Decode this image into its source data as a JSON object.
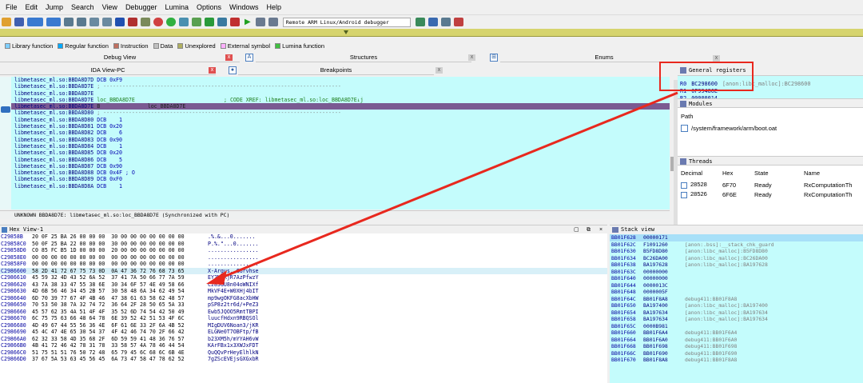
{
  "menu": [
    "File",
    "Edit",
    "Jump",
    "Search",
    "View",
    "Debugger",
    "Lumina",
    "Options",
    "Windows",
    "Help"
  ],
  "toolbar": {
    "debugger_select": "Remote ARM Linux/Android debugger"
  },
  "legend": [
    {
      "label": "Library function",
      "color": "#7fcfff"
    },
    {
      "label": "Regular function",
      "color": "#00aaff"
    },
    {
      "label": "Instruction",
      "color": "#c07060"
    },
    {
      "label": "Data",
      "color": "#c0c0c0"
    },
    {
      "label": "Unexplored",
      "color": "#b0b060"
    },
    {
      "label": "External symbol",
      "color": "#ffb0ff"
    },
    {
      "label": "Lumina function",
      "color": "#40c040"
    }
  ],
  "panes": {
    "debug_view": "Debug View",
    "structures": "Structures",
    "enums": "Enums",
    "ida_view": "IDA View-PC",
    "breakpoints": "Breakpoints",
    "general_registers": "General registers",
    "modules": "Modules",
    "threads": "Threads",
    "hex_view": "Hex View-1",
    "stack_view": "Stack view"
  },
  "ida_lines": [
    {
      "addr": "libmetasec_ml.so:BBDA8D7D",
      "body": " DCB 0xF9",
      "cls": "bl"
    },
    {
      "addr": "libmetasec_ml.so:BBDA8D7E",
      "body": " ; ---------------------------------------------------------------------------",
      "cls": "gy"
    },
    {
      "addr": "libmetasec_ml.so:BBDA8D7E",
      "body": "",
      "cls": ""
    },
    {
      "addr": "libmetasec_ml.so:BBDA8D7E",
      "body": " loc_BBDA8D7E                            ; CODE XREF: libmetasec_ml.so:loc_BBDA8D7E↓j",
      "cls": "gr"
    },
    {
      "addr": "libmetasec_ml.so:BBDA8D7E",
      "body": " B               loc_BBDA8D7E",
      "cls": "hl"
    },
    {
      "addr": "libmetasec_ml.so:BBDA8D80",
      "body": " ; ---------------------------------------------------------------------------",
      "cls": "gy"
    },
    {
      "addr": "libmetasec_ml.so:BBDA8D80",
      "body": " DCB    1",
      "cls": "bl"
    },
    {
      "addr": "libmetasec_ml.so:BBDA8D81",
      "body": " DCB 0x20",
      "cls": "bl"
    },
    {
      "addr": "libmetasec_ml.so:BBDA8D82",
      "body": " DCB    6",
      "cls": "bl"
    },
    {
      "addr": "libmetasec_ml.so:BBDA8D83",
      "body": " DCB 0x90",
      "cls": "bl"
    },
    {
      "addr": "libmetasec_ml.so:BBDA8D84",
      "body": " DCB    1",
      "cls": "bl"
    },
    {
      "addr": "libmetasec_ml.so:BBDA8D85",
      "body": " DCB 0x20",
      "cls": "bl"
    },
    {
      "addr": "libmetasec_ml.so:BBDA8D86",
      "body": " DCB    5",
      "cls": "bl"
    },
    {
      "addr": "libmetasec_ml.so:BBDA8D87",
      "body": " DCB 0x90",
      "cls": "bl"
    },
    {
      "addr": "libmetasec_ml.so:BBDA8D88",
      "body": " DCB 0x4F ; O",
      "cls": "bl"
    },
    {
      "addr": "libmetasec_ml.so:BBDA8D89",
      "body": " DCB 0xF0",
      "cls": "bl"
    },
    {
      "addr": "libmetasec_ml.so:BBDA8D8A",
      "body": " DCB    1",
      "cls": "bl"
    }
  ],
  "ida_status": "UNKNOWN BBDA8D7E: libmetasec_ml.so:loc_BBDA8D7E (Synchronized with PC)",
  "registers": [
    {
      "name": "R0",
      "value": "BC298600",
      "info": "[anon:libc_malloc]:BC298600"
    },
    {
      "name": "R1",
      "value": "6F99486E",
      "info": ""
    },
    {
      "name": "R2",
      "value": "00000014",
      "info": ""
    }
  ],
  "modules": {
    "header": "Path",
    "items": [
      "/system/framework/arm/boot.oat"
    ]
  },
  "threads": {
    "columns": [
      "Decimal",
      "Hex",
      "State",
      "Name"
    ],
    "rows": [
      [
        "28528",
        "6F70",
        "Ready",
        "RxComputationTh"
      ],
      [
        "28526",
        "6F6E",
        "Ready",
        "RxComputationTh"
      ]
    ]
  },
  "hex_rows": [
    [
      "C29858B",
      "20 0F 25 BA 26 00 00 00  30 00 00 00 00 00 00 00",
      ".%.&...0......."
    ],
    [
      "C29858C0",
      "50 0F 25 BA 22 00 00 00  30 00 00 00 00 00 00 00",
      "P.%.\"...0......."
    ],
    [
      "C29858D0",
      "C0 85 FC B5 1D 00 00 00  20 00 00 00 00 00 00 00",
      "................"
    ],
    [
      "C29858E0",
      "00 00 00 00 00 00 00 00  00 00 00 00 00 00 00 00",
      "................"
    ],
    [
      "C29858F0",
      "00 00 00 00 00 00 00 00  00 00 00 00 00 00 00 00",
      "................"
    ],
    [
      "C2986600",
      "58 2D 41 72 67 75 73 0D  0A 47 36 72 76 68 73 65",
      "X-Argus..G6rvhse"
    ],
    [
      "C2986610",
      "45 59 32 4D 43 52 6A 52  37 41 7A 50 66 77 7A 59",
      "EY2MCRjR7AzPfwzY"
    ],
    [
      "C2986620",
      "43 7A 38 33 47 55 38 6E  30 34 6F 57 4E 49 58 66",
      "Cz83GU8n04oWNIXf"
    ],
    [
      "C2986630",
      "4D 6B 56 46 34 45 2B 57  30 58 48 6A 34 62 49 54",
      "MkVF4E+W0XHj4bIT"
    ],
    [
      "C2986640",
      "6D 70 39 77 67 4F 4B 46  47 38 61 63 58 62 48 57",
      "mp9wgOKFG8acXbHW"
    ],
    [
      "C2986650",
      "70 53 50 38 7A 32 74 72  36 64 2F 28 50 65 5A 33",
      "pSP8z2tr6d/+PeZ3"
    ],
    [
      "C2986660",
      "45 57 62 35 4A 51 4F 4F  35 52 6D 74 54 42 50 49",
      "Ewb5JQOO5RmtTBPI"
    ],
    [
      "C2986670",
      "6C 75 75 63 66 48 64 78  6E 39 52 42 51 53 4F 6C",
      "luucfHdxn9RBQSOl"
    ],
    [
      "C2986680",
      "4D 49 67 44 55 56 36 4E  6F 61 6E 33 2F 6A 4B 52",
      "MIgDUV6Noan3/jKR"
    ],
    [
      "C2986690",
      "45 4C 47 4E 65 30 54 37  4F 42 46 74 70 2F 66 42",
      "ELGNe0T7OBFtp/fB"
    ],
    [
      "C29866A0",
      "62 32 33 58 4D 35 68 2F  6D 59 59 41 48 36 76 57",
      "b23XM5h/mYYAH6vW"
    ],
    [
      "C29866B0",
      "4B 41 72 46 42 78 31 78  33 58 57 4A 78 46 44 54",
      "KArFBx1x3XWJxFDT"
    ],
    [
      "C29866C0",
      "51 75 51 51 76 50 72 48  65 79 45 6C 68 6C 6B 4E",
      "QuQQvPrHeyElhlkN"
    ],
    [
      "C29866D0",
      "37 67 5A 53 63 45 56 45  6A 73 47 58 47 78 62 52",
      "7gZScEVEjsGXGxbR"
    ]
  ],
  "stack_rows": [
    [
      "BB01F628",
      "00000171",
      ""
    ],
    [
      "BB01F62C",
      "F1091260",
      "[anon:.bss]:__stack_chk_guard"
    ],
    [
      "BB01F630",
      "B5FD8D80",
      "[anon:libc_malloc]:B5FD8D80"
    ],
    [
      "BB01F634",
      "BC26DA00",
      "[anon:libc_malloc]:BC26DA00"
    ],
    [
      "BB01F638",
      "BA197628",
      "[anon:libc_malloc]:BA197628"
    ],
    [
      "BB01F63C",
      "00000000",
      ""
    ],
    [
      "BB01F640",
      "00000000",
      ""
    ],
    [
      "BB01F644",
      "0000013C",
      ""
    ],
    [
      "BB01F648",
      "0000005F",
      ""
    ],
    [
      "BB01F64C",
      "BB01F8A8",
      "debug411:BB01F8A8"
    ],
    [
      "BB01F650",
      "BA197400",
      "[anon:libc_malloc]:BA197400"
    ],
    [
      "BB01F654",
      "BA197634",
      "[anon:libc_malloc]:BA197634"
    ],
    [
      "BB01F658",
      "BA197634",
      "[anon:libc_malloc]:BA197634"
    ],
    [
      "BB01F65C",
      "0000B981",
      ""
    ],
    [
      "BB01F660",
      "BB01F6A4",
      "debug411:BB01F6A4"
    ],
    [
      "BB01F664",
      "BB01F6A0",
      "debug411:BB01F6A0"
    ],
    [
      "BB01F668",
      "BB01F698",
      "debug411:BB01F698"
    ],
    [
      "BB01F66C",
      "BB01F690",
      "debug411:BB01F690"
    ],
    [
      "BB01F670",
      "BB01F8A8",
      "debug411:BB01F8A8"
    ]
  ],
  "colors": {
    "ida_bg": "#c4fcfc",
    "highlight": "#7a5a92",
    "annotation": "#e8281e"
  }
}
